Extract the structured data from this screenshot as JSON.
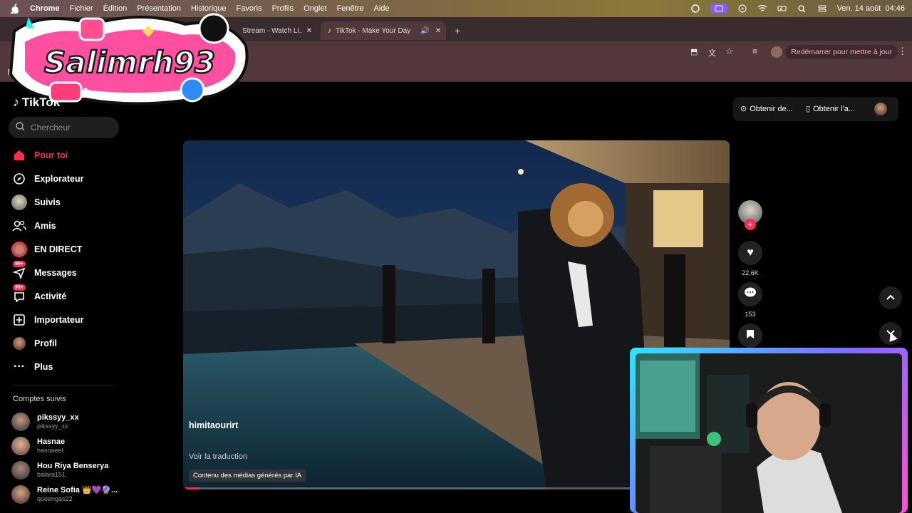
{
  "mac_menubar": {
    "app": "Chrome",
    "menus": [
      "Fichier",
      "Édition",
      "Présentation",
      "Historique",
      "Favoris",
      "Profils",
      "Onglet",
      "Fenêtre",
      "Aide"
    ],
    "clock": "Ven. 14 août  04:46"
  },
  "browser": {
    "tabs": [
      {
        "title": "Stream - Watch Li...",
        "active": false
      },
      {
        "title": "TikTok - Make Your Day",
        "active": true
      }
    ],
    "restart_label": "Redémarrer pour mettre à jour"
  },
  "overlay": {
    "text": "Salimrh93",
    "badge_count": "1"
  },
  "tiktok": {
    "logo_text": "TikTok",
    "search_placeholder": "Chercheur",
    "nav": [
      {
        "label": "Pour toi",
        "icon": "home-icon",
        "active": true
      },
      {
        "label": "Explorateur",
        "icon": "compass-icon"
      },
      {
        "label": "Suivis",
        "icon": "following-avatar-icon"
      },
      {
        "label": "Amis",
        "icon": "friends-icon"
      },
      {
        "label": "EN DIRECT",
        "icon": "live-icon"
      },
      {
        "label": "Messages",
        "icon": "messages-icon",
        "badge": "99+"
      },
      {
        "label": "Activité",
        "icon": "activity-icon",
        "badge": "99+"
      },
      {
        "label": "Importateur",
        "icon": "upload-icon"
      },
      {
        "label": "Profil",
        "icon": "profile-avatar-icon"
      },
      {
        "label": "Plus",
        "icon": "more-icon"
      }
    ],
    "following_title": "Comptes suivis",
    "accounts": [
      {
        "name": "pikssyy_xx",
        "handle": "pikssyy_xx"
      },
      {
        "name": "Hasnae",
        "handle": "hasnaeet"
      },
      {
        "name": "Hou Riya Benserya",
        "handle": "balara151"
      },
      {
        "name": "Reine Sofia 👑💜🔮...",
        "handle": "queengas22"
      }
    ],
    "top_buttons": {
      "coins": "Obtenir de...",
      "app": "Obtenir l'a..."
    },
    "video": {
      "author": "himitaourirt",
      "translate": "Voir la traduction",
      "ai_label": "Contenu des médias générés par IA",
      "progress": 0.03
    },
    "actions": {
      "likes": "22,6K",
      "comments": "153"
    }
  },
  "colors": {
    "accent": "#fe2c55",
    "cam_border_start": "#2fe6ff",
    "cam_border_end": "#ff4fd8"
  }
}
